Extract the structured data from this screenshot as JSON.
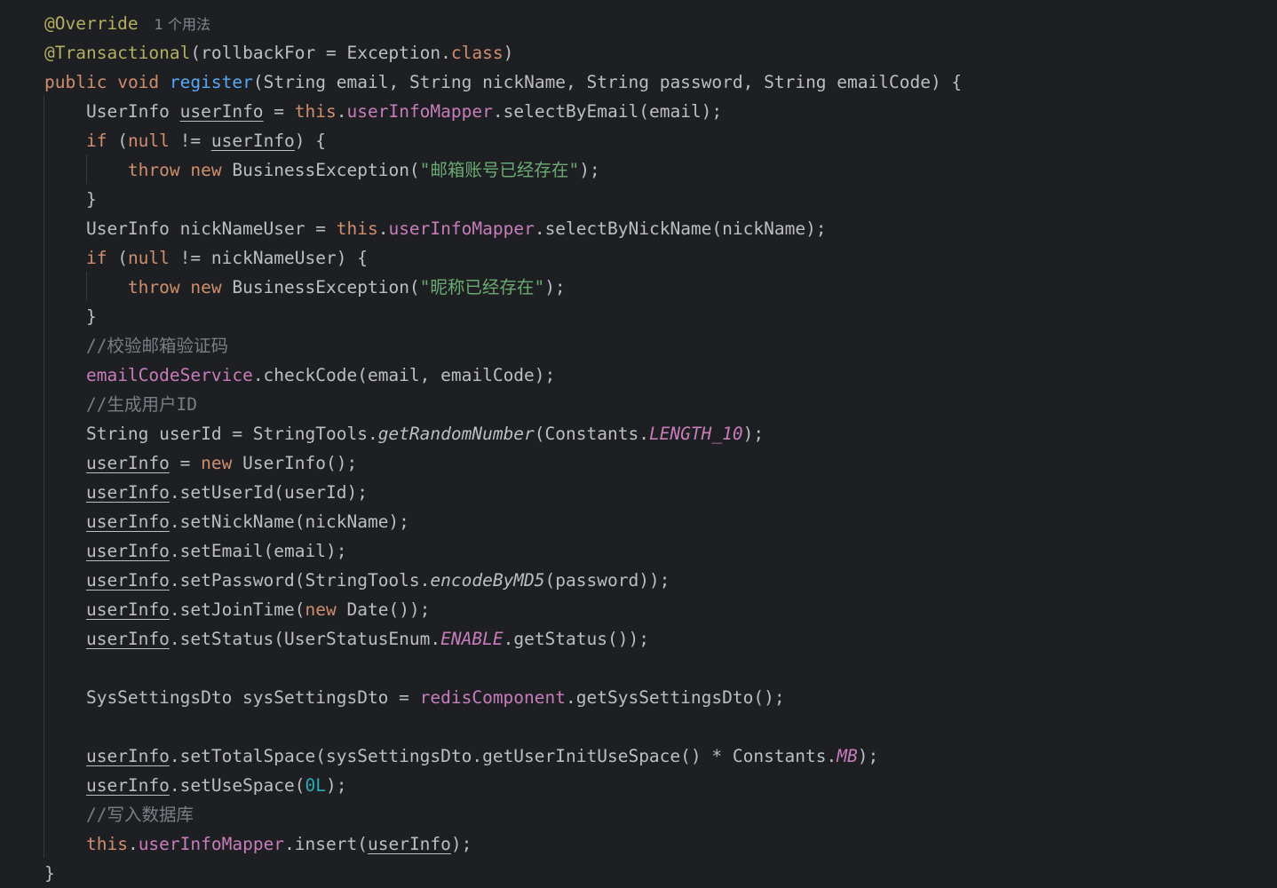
{
  "editor": {
    "language": "Java",
    "usage_hint": "1 个用法",
    "lines": [
      {
        "id": "l1",
        "tokens": [
          [
            "annot",
            "@Override"
          ]
        ],
        "hint": true
      },
      {
        "id": "l2",
        "tokens": [
          [
            "annot",
            "@Transactional"
          ],
          [
            "plain",
            "(rollbackFor = Exception."
          ],
          [
            "kw",
            "class"
          ],
          [
            "plain",
            ")"
          ]
        ]
      },
      {
        "id": "l3",
        "tokens": [
          [
            "kw",
            "public"
          ],
          [
            "plain",
            " "
          ],
          [
            "kw",
            "void"
          ],
          [
            "plain",
            " "
          ],
          [
            "fn-decl",
            "register"
          ],
          [
            "plain",
            "(String email, String nickName, String password, String emailCode) {"
          ]
        ]
      },
      {
        "id": "l4",
        "tokens": [
          [
            "plain",
            "    UserInfo "
          ],
          [
            "reassigned",
            "userInfo"
          ],
          [
            "plain",
            " = "
          ],
          [
            "kw",
            "this"
          ],
          [
            "plain",
            "."
          ],
          [
            "field",
            "userInfoMapper"
          ],
          [
            "plain",
            ".selectByEmail(email);"
          ]
        ]
      },
      {
        "id": "l5",
        "tokens": [
          [
            "plain",
            "    "
          ],
          [
            "kw",
            "if"
          ],
          [
            "plain",
            " ("
          ],
          [
            "kw",
            "null"
          ],
          [
            "plain",
            " != "
          ],
          [
            "reassigned",
            "userInfo"
          ],
          [
            "plain",
            ") {"
          ]
        ]
      },
      {
        "id": "l6",
        "tokens": [
          [
            "plain",
            "        "
          ],
          [
            "kw",
            "throw"
          ],
          [
            "plain",
            " "
          ],
          [
            "kw",
            "new"
          ],
          [
            "plain",
            " BusinessException("
          ],
          [
            "str",
            "\""
          ],
          [
            "str-cjk",
            "邮箱账号已经存在"
          ],
          [
            "str",
            "\""
          ],
          [
            "plain",
            ");"
          ]
        ]
      },
      {
        "id": "l7",
        "tokens": [
          [
            "plain",
            "    }"
          ]
        ]
      },
      {
        "id": "l8",
        "tokens": [
          [
            "plain",
            "    UserInfo nickNameUser = "
          ],
          [
            "kw",
            "this"
          ],
          [
            "plain",
            "."
          ],
          [
            "field",
            "userInfoMapper"
          ],
          [
            "plain",
            ".selectByNickName(nickName);"
          ]
        ]
      },
      {
        "id": "l9",
        "tokens": [
          [
            "plain",
            "    "
          ],
          [
            "kw",
            "if"
          ],
          [
            "plain",
            " ("
          ],
          [
            "kw",
            "null"
          ],
          [
            "plain",
            " != nickNameUser) {"
          ]
        ]
      },
      {
        "id": "l10",
        "tokens": [
          [
            "plain",
            "        "
          ],
          [
            "kw",
            "throw"
          ],
          [
            "plain",
            " "
          ],
          [
            "kw",
            "new"
          ],
          [
            "plain",
            " BusinessException("
          ],
          [
            "str",
            "\""
          ],
          [
            "str-cjk",
            "昵称已经存在"
          ],
          [
            "str",
            "\""
          ],
          [
            "plain",
            ");"
          ]
        ]
      },
      {
        "id": "l11",
        "tokens": [
          [
            "plain",
            "    }"
          ]
        ]
      },
      {
        "id": "l12",
        "tokens": [
          [
            "plain",
            "    "
          ],
          [
            "cmt",
            "//"
          ],
          [
            "cmt-cjk",
            "校验邮箱验证码"
          ]
        ]
      },
      {
        "id": "l13",
        "tokens": [
          [
            "plain",
            "    "
          ],
          [
            "field",
            "emailCodeService"
          ],
          [
            "plain",
            ".checkCode(email, emailCode);"
          ]
        ]
      },
      {
        "id": "l14",
        "tokens": [
          [
            "plain",
            "    "
          ],
          [
            "cmt",
            "//"
          ],
          [
            "cmt-cjk",
            "生成用户"
          ],
          [
            "cmt",
            "ID"
          ]
        ]
      },
      {
        "id": "l15",
        "tokens": [
          [
            "plain",
            "    String userId = StringTools."
          ],
          [
            "italic",
            "getRandomNumber"
          ],
          [
            "plain",
            "(Constants."
          ],
          [
            "static-italic",
            "LENGTH_10"
          ],
          [
            "plain",
            ");"
          ]
        ]
      },
      {
        "id": "l16",
        "tokens": [
          [
            "plain",
            "    "
          ],
          [
            "reassigned",
            "userInfo"
          ],
          [
            "plain",
            " = "
          ],
          [
            "kw",
            "new"
          ],
          [
            "plain",
            " UserInfo();"
          ]
        ]
      },
      {
        "id": "l17",
        "tokens": [
          [
            "plain",
            "    "
          ],
          [
            "reassigned",
            "userInfo"
          ],
          [
            "plain",
            ".setUserId(userId);"
          ]
        ]
      },
      {
        "id": "l18",
        "tokens": [
          [
            "plain",
            "    "
          ],
          [
            "reassigned",
            "userInfo"
          ],
          [
            "plain",
            ".setNickName(nickName);"
          ]
        ]
      },
      {
        "id": "l19",
        "tokens": [
          [
            "plain",
            "    "
          ],
          [
            "reassigned",
            "userInfo"
          ],
          [
            "plain",
            ".setEmail(email);"
          ]
        ]
      },
      {
        "id": "l20",
        "tokens": [
          [
            "plain",
            "    "
          ],
          [
            "reassigned",
            "userInfo"
          ],
          [
            "plain",
            ".setPassword(StringTools."
          ],
          [
            "italic",
            "encodeByMD5"
          ],
          [
            "plain",
            "(password));"
          ]
        ]
      },
      {
        "id": "l21",
        "tokens": [
          [
            "plain",
            "    "
          ],
          [
            "reassigned",
            "userInfo"
          ],
          [
            "plain",
            ".setJoinTime("
          ],
          [
            "kw",
            "new"
          ],
          [
            "plain",
            " Date());"
          ]
        ]
      },
      {
        "id": "l22",
        "tokens": [
          [
            "plain",
            "    "
          ],
          [
            "reassigned",
            "userInfo"
          ],
          [
            "plain",
            ".setStatus(UserStatusEnum."
          ],
          [
            "static-italic",
            "ENABLE"
          ],
          [
            "plain",
            ".getStatus());"
          ]
        ]
      },
      {
        "id": "l23",
        "tokens": []
      },
      {
        "id": "l24",
        "tokens": [
          [
            "plain",
            "    SysSettingsDto sysSettingsDto = "
          ],
          [
            "field",
            "redisComponent"
          ],
          [
            "plain",
            ".getSysSettingsDto();"
          ]
        ]
      },
      {
        "id": "l25",
        "tokens": []
      },
      {
        "id": "l26",
        "tokens": [
          [
            "plain",
            "    "
          ],
          [
            "reassigned",
            "userInfo"
          ],
          [
            "plain",
            ".setTotalSpace(sysSettingsDto.getUserInitUseSpace() * Constants."
          ],
          [
            "static-italic",
            "MB"
          ],
          [
            "plain",
            ");"
          ]
        ]
      },
      {
        "id": "l27",
        "tokens": [
          [
            "plain",
            "    "
          ],
          [
            "reassigned",
            "userInfo"
          ],
          [
            "plain",
            ".setUseSpace("
          ],
          [
            "num",
            "0L"
          ],
          [
            "plain",
            ");"
          ]
        ]
      },
      {
        "id": "l28",
        "tokens": [
          [
            "plain",
            "    "
          ],
          [
            "cmt",
            "//"
          ],
          [
            "cmt-cjk",
            "写入数据库"
          ]
        ]
      },
      {
        "id": "l29",
        "tokens": [
          [
            "plain",
            "    "
          ],
          [
            "kw",
            "this"
          ],
          [
            "plain",
            "."
          ],
          [
            "field",
            "userInfoMapper"
          ],
          [
            "plain",
            ".insert("
          ],
          [
            "reassigned",
            "userInfo"
          ],
          [
            "plain",
            ");"
          ]
        ]
      },
      {
        "id": "l30",
        "tokens": [
          [
            "plain",
            "}"
          ]
        ]
      }
    ]
  },
  "colors": {
    "background": "#1e1f22",
    "text": "#bcbec4",
    "annotation": "#b3ae60",
    "keyword": "#cf8e6d",
    "function_declaration": "#56a8f5",
    "field": "#c77dbb",
    "string": "#6aab73",
    "comment": "#7a7e85",
    "number": "#2aacb8",
    "indent_guide": "#393b40"
  }
}
